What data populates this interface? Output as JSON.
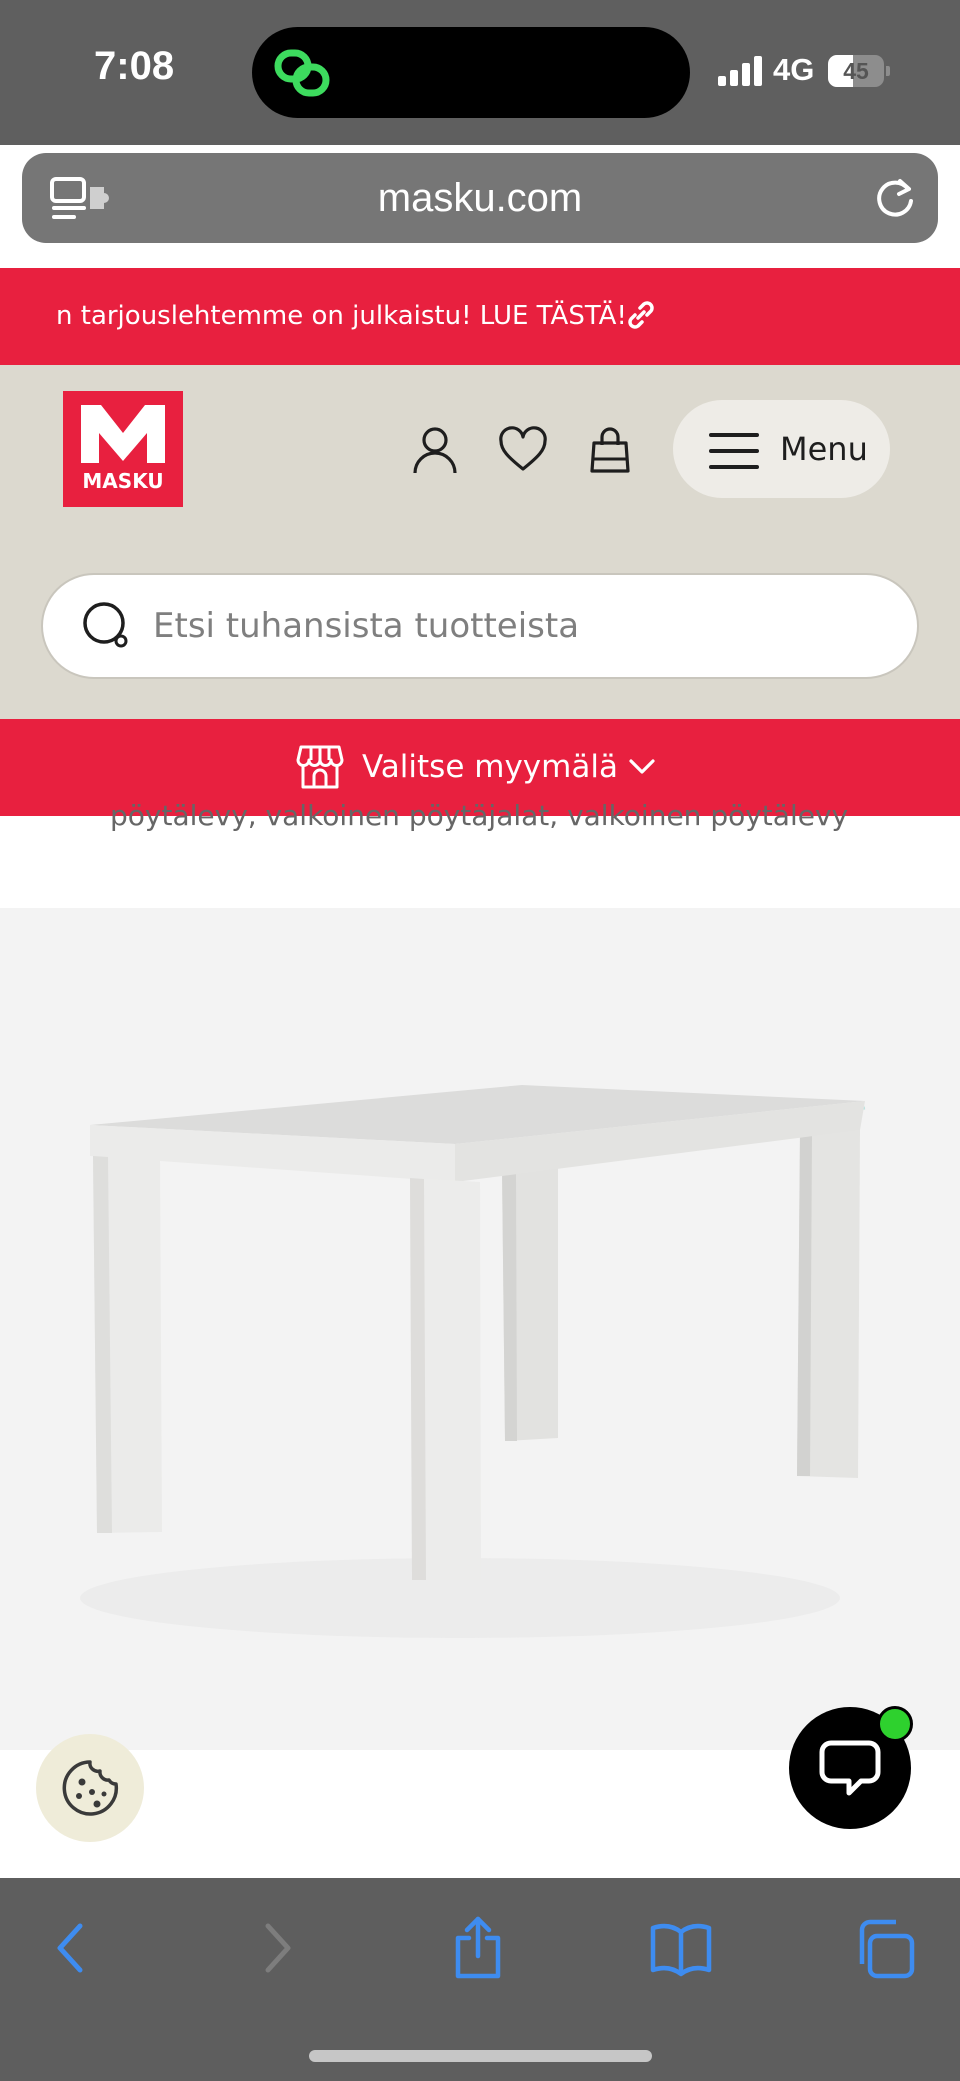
{
  "status_bar": {
    "time": "7:08",
    "network": "4G",
    "battery_text": "45",
    "battery_level": 0.45
  },
  "browser": {
    "url": "masku.com",
    "left_icon": "tabs-pill-icon",
    "reload_icon": "reload-icon"
  },
  "promo_banner": {
    "text": "n tarjouslehtemme on julkaistu! LUE TÄSTÄ!",
    "icon": "link-icon",
    "color": "#e8203f"
  },
  "header": {
    "logo_text": "MASKU",
    "account_icon": "user-icon",
    "wishlist_icon": "heart-icon",
    "cart_icon": "shopping-bag-icon",
    "menu_label": "Menu",
    "background": "#dcd9cf"
  },
  "search": {
    "placeholder": "Etsi tuhansista tuotteista",
    "value": ""
  },
  "store_selector": {
    "label": "Valitse myymälä",
    "icon": "storefront-icon",
    "chevron": "chevron-down-icon"
  },
  "product": {
    "cut_text": "pöytälevy, valkoinen pöytäjalat, valkoinen pöytälevy",
    "image_alt": "white-dining-table"
  },
  "floating": {
    "cookie_icon": "cookie-icon",
    "chat_icon": "chat-icon",
    "chat_status_color": "#2ed12e"
  },
  "toolbar": {
    "icons": [
      "back-icon",
      "forward-icon",
      "share-icon",
      "bookmarks-icon",
      "tabs-icon"
    ],
    "accent": "#3e8cf0"
  }
}
